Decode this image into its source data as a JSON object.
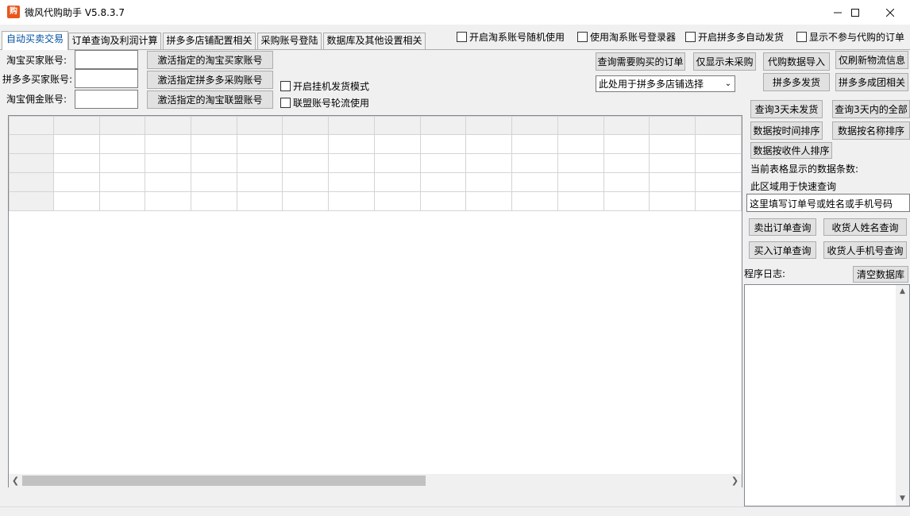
{
  "window": {
    "title": "微风代购助手 V5.8.3.7",
    "app_icon_text": "购",
    "minimize_icon": "minimize-icon",
    "maximize_icon": "maximize-icon",
    "close_icon": "close-icon"
  },
  "tabs": [
    {
      "label": "自动买卖交易",
      "active": true
    },
    {
      "label": "订单查询及利润计算",
      "active": false
    },
    {
      "label": "拼多多店铺配置相关",
      "active": false
    },
    {
      "label": "采购账号登陆",
      "active": false
    },
    {
      "label": "数据库及其他设置相关",
      "active": false
    }
  ],
  "top_checkboxes": [
    {
      "label": "开启淘系账号随机使用",
      "checked": false
    },
    {
      "label": "使用淘系账号登录器",
      "checked": false
    },
    {
      "label": "开启拼多多自动发货",
      "checked": false
    },
    {
      "label": "显示不参与代购的订单",
      "checked": false
    }
  ],
  "accounts": {
    "taobao_buyer_label": "淘宝买家账号:",
    "taobao_buyer_value": "",
    "pdd_buyer_label": "拼多多买家账号:",
    "pdd_buyer_value": "",
    "taobao_commission_label": "淘宝佣金账号:",
    "taobao_commission_value": "",
    "activate_taobao_buyer": "激活指定的淘宝买家账号",
    "activate_pdd_buyer": "激活指定拼多多采购账号",
    "activate_taobao_union": "激活指定的淘宝联盟账号"
  },
  "mode_checkboxes": [
    {
      "label": "开启挂机发货模式",
      "checked": false
    },
    {
      "label": "联盟账号轮流使用",
      "checked": false
    }
  ],
  "actions": {
    "query_orders_to_buy": "查询需要购买的订单",
    "show_unpurchased": "仅显示未采购",
    "import_data": "代购数据导入",
    "refresh_logistics": "仅刷新物流信息",
    "store_select_value": "此处用于拼多多店铺选择",
    "pdd_ship": "拼多多发货",
    "pdd_group": "拼多多成团相关",
    "query_3days_unshipped": "查询3天未发货",
    "query_3days_all": "查询3天内的全部",
    "sort_by_time": "数据按时间排序",
    "sort_by_name": "数据按名称排序",
    "sort_by_recipient": "数据按收件人排序",
    "record_count_label": "当前表格显示的数据条数:",
    "quick_query_label": "此区域用于快速查询",
    "quick_query_value": "这里填写订单号或姓名或手机号码",
    "sold_order_query": "卖出订单查询",
    "recipient_name_query": "收货人姓名查询",
    "bought_order_query": "买入订单查询",
    "recipient_phone_query": "收货人手机号查询",
    "log_label": "程序日志:",
    "clear_db": "清空数据库"
  },
  "grid": {
    "rows": 5,
    "cols": 16,
    "scroll_thumb_fraction": 0.55
  }
}
